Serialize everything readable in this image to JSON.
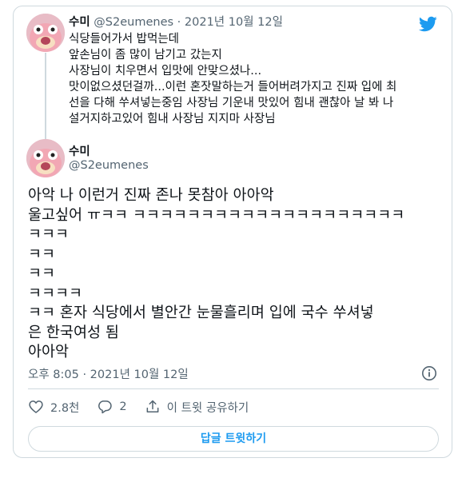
{
  "previous_tweet": {
    "name": "수미",
    "handle": "@S2eumenes",
    "separator": "·",
    "date": "2021년 10월 12일",
    "lines": [
      "식당들어가서 밥먹는데",
      "앞손님이 좀 많이 남기고 갔는지",
      "사장님이 치우면서 입맛에 안맞으셨나...",
      "맛이없으셨던걸까...이런 혼잣말하는거 들어버려가지고 진짜 입에 최",
      "선을 다해 쑤셔넣는중임 사장님 기운내 맛있어 힘내 괜찮아 날 봐 나",
      "설거지하고있어 힘내 사장님 지지마 사장님"
    ]
  },
  "main_tweet": {
    "name": "수미",
    "handle": "@S2eumenes",
    "lines": [
      "아악 나 이런거 진짜 존나 못참아 아아악",
      "울고싶어 ㅠㅋㅋ ㅋㅋㅋㅋㅋㅋㅋㅋㅋㅋㅋㅋㅋㅋㅋㅋㅋㅋㅋㅋ",
      "ㅋㅋㅋ",
      "ㅋㅋ",
      "ㅋㅋ",
      "ㅋㅋㅋㅋ",
      "ㅋㅋ 혼자 식당에서 별안간 눈물흘리며 입에 국수 쑤셔넣",
      "은 한국여성 됨",
      "아아악"
    ],
    "timestamp": "오후 8:05 · 2021년 10월 12일"
  },
  "actions": {
    "like_count": "2.8천",
    "reply_count": "2",
    "share_label": "이 트윗 공유하기"
  },
  "reply_button_label": "답글 트윗하기",
  "colors": {
    "accent": "#1d9bf0",
    "secondary_text": "#536471",
    "border": "#cfd9de"
  },
  "icons": [
    "twitter-bird-icon",
    "info-icon",
    "heart-icon",
    "reply-bubble-icon",
    "share-icon"
  ]
}
